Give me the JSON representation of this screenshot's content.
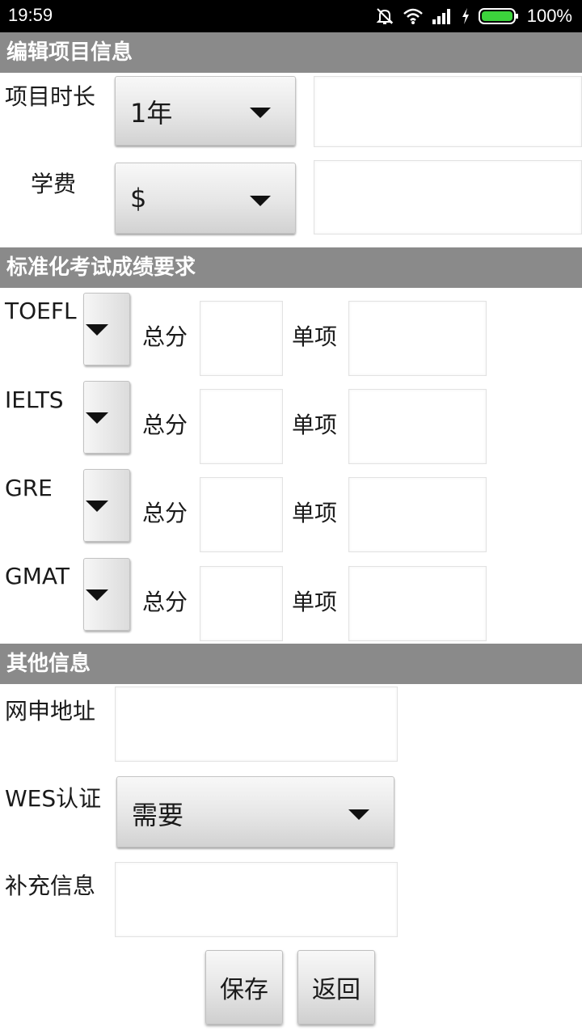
{
  "status_bar": {
    "time": "19:59",
    "battery": "100%",
    "icons": [
      "bell-off-icon",
      "wifi-icon",
      "signal-icon",
      "charging-icon",
      "battery-icon"
    ]
  },
  "header": {
    "title": "编辑项目信息"
  },
  "project": {
    "duration_label": "项目时长",
    "duration_value": "1年",
    "duration_input": "",
    "tuition_label": "学费",
    "currency_value": "$",
    "tuition_input": ""
  },
  "exam_section": {
    "title": "标准化考试成绩要求",
    "total_label": "总分",
    "single_label": "单项",
    "exams": [
      {
        "name": "TOEFL",
        "total": "",
        "single": ""
      },
      {
        "name": "IELTS",
        "total": "",
        "single": ""
      },
      {
        "name": "GRE",
        "total": "",
        "single": ""
      },
      {
        "name": "GMAT",
        "total": "",
        "single": ""
      }
    ]
  },
  "other_section": {
    "title": "其他信息",
    "url_label": "网申地址",
    "url_value": "",
    "wes_label": "WES认证",
    "wes_value": "需要",
    "notes_label": "补充信息",
    "notes_value": ""
  },
  "actions": {
    "save": "保存",
    "back": "返回"
  },
  "colors": {
    "section_bg": "#8a8a8a",
    "status_bg": "#000000",
    "battery_green": "#3cd33c"
  }
}
